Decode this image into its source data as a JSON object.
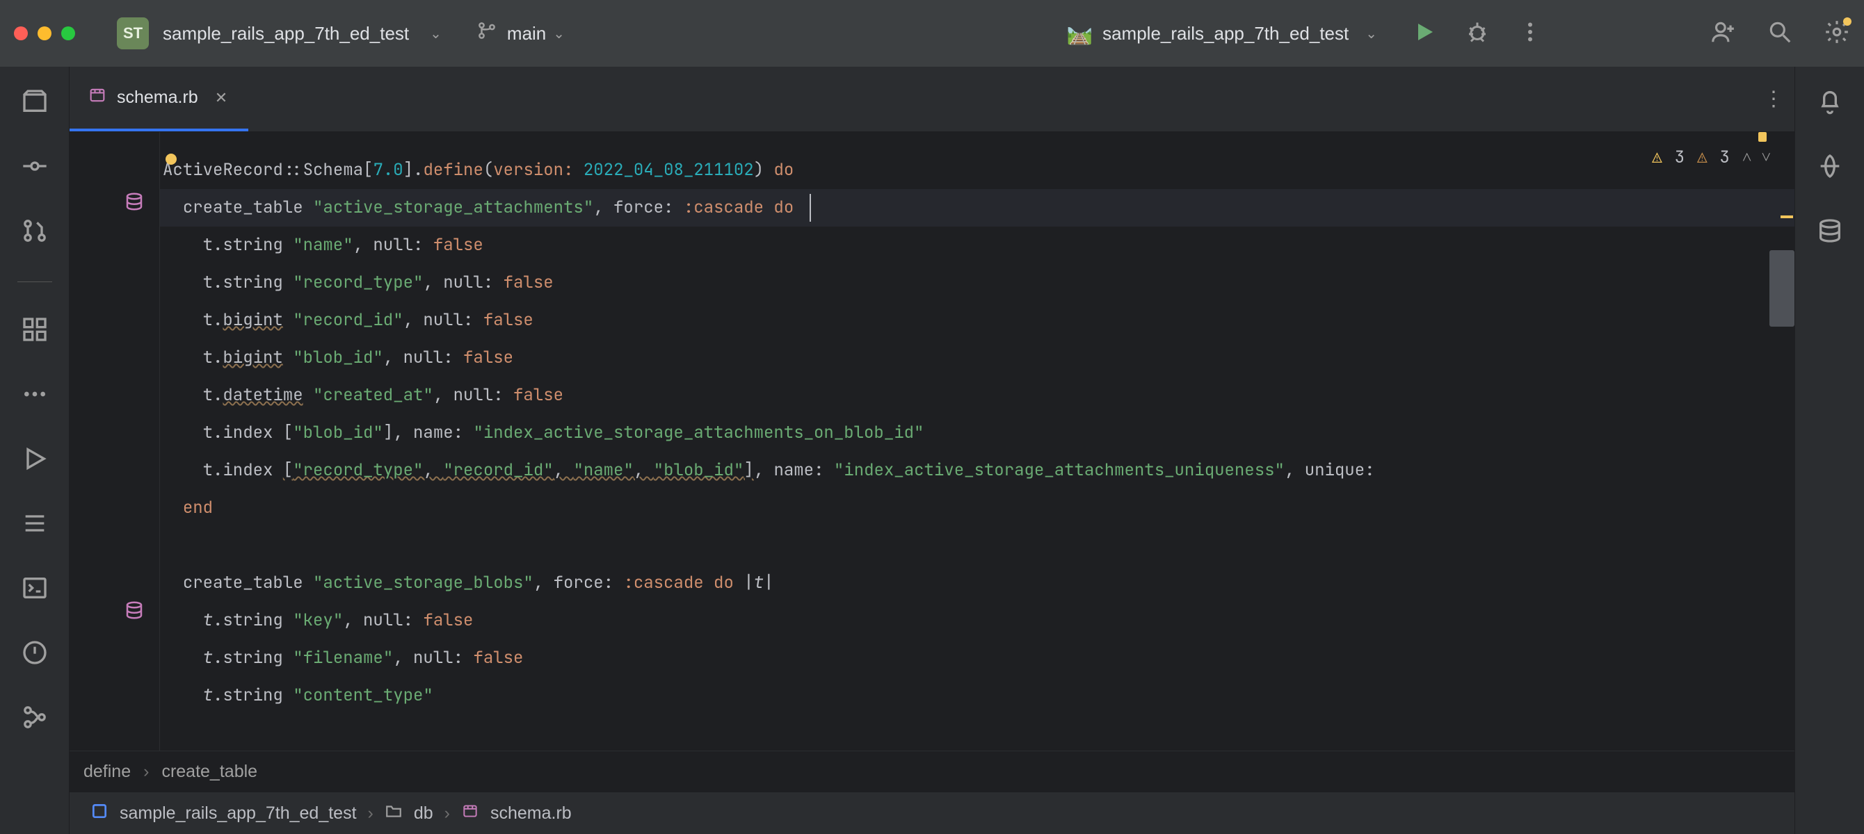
{
  "titlebar": {
    "project_initials": "ST",
    "project_name": "sample_rails_app_7th_ed_test",
    "branch": "main",
    "run_config": "sample_rails_app_7th_ed_test"
  },
  "tab": {
    "filename": "schema.rb"
  },
  "warnings": {
    "yellow_count": "3",
    "tan_count": "3"
  },
  "code": {
    "l1_a": "A",
    "l1_b": "ctiveRecord",
    "l1_sep": "::",
    "l1_c": "Schema",
    "l1_bracket_open": "[",
    "l1_ver": "7.0",
    "l1_bracket_close": "].",
    "l1_define": "define",
    "l1_paren_open": "(",
    "l1_version_kw": "version: ",
    "l1_version_val": "2022_04_08_211102",
    "l1_paren_close": ") ",
    "l1_do": "do",
    "l2_indent": "  ",
    "l2_ct": "create_table ",
    "l2_str": "\"active_storage_attachments\"",
    "l2_force": ", force: ",
    "l2_cascade": ":cascade",
    "l2_do": " do ",
    "l3": "    t.",
    "l3_string": "string",
    "l3_name": " \"name\"",
    "l3_null": ", null: ",
    "l3_false": "false",
    "l4": "    t.",
    "l4_string": "string",
    "l4_name": " \"record_type\"",
    "l4_null": ", null: ",
    "l4_false": "false",
    "l5": "    t.",
    "l5_bigint": "bigint",
    "l5_name": " \"record_id\"",
    "l5_null": ", null: ",
    "l5_false": "false",
    "l6": "    t.",
    "l6_bigint": "bigint",
    "l6_name": " \"blob_id\"",
    "l6_null": ", null: ",
    "l6_false": "false",
    "l7": "    t.",
    "l7_dt": "datetime",
    "l7_name": " \"created_at\"",
    "l7_null": ", null: ",
    "l7_false": "false",
    "l8": "    t.",
    "l8_index": "index ",
    "l8_arr": "[\"blob_id\"]",
    "l8_name_kw": ", name: ",
    "l8_name_str": "\"index_active_storage_attachments_on_blob_id\"",
    "l9": "    t.",
    "l9_index": "index ",
    "l9_arr": "[\"record_type\", \"record_id\", \"name\", \"blob_id\"]",
    "l9_name_kw": ", name: ",
    "l9_name_str": "\"index_active_storage_attachments_uniqueness\"",
    "l9_unique": ", unique:",
    "l10": "  ",
    "l10_end": "end",
    "l12_indent": "  ",
    "l12_ct": "create_table ",
    "l12_str": "\"active_storage_blobs\"",
    "l12_force": ", force: ",
    "l12_cascade": ":cascade",
    "l12_do": " do ",
    "l12_pipe": "|",
    "l12_t": "t",
    "l12_pipe2": "|",
    "l13": "    ",
    "l13_t": "t",
    "l13_dot": ".",
    "l13_string": "string",
    "l13_name": " \"key\"",
    "l13_null": ", null: ",
    "l13_false": "false",
    "l14": "    ",
    "l14_t": "t",
    "l14_dot": ".",
    "l14_string": "string",
    "l14_name": " \"filename\"",
    "l14_null": ", null: ",
    "l14_false": "false",
    "l15": "    ",
    "l15_t": "t",
    "l15_dot": ".",
    "l15_string": "string",
    "l15_name": " \"content_type\""
  },
  "breadcrumb_inner": {
    "a": "define",
    "b": "create_table"
  },
  "bottom_nav": {
    "project": "sample_rails_app_7th_ed_test",
    "folder": "db",
    "file": "schema.rb"
  }
}
